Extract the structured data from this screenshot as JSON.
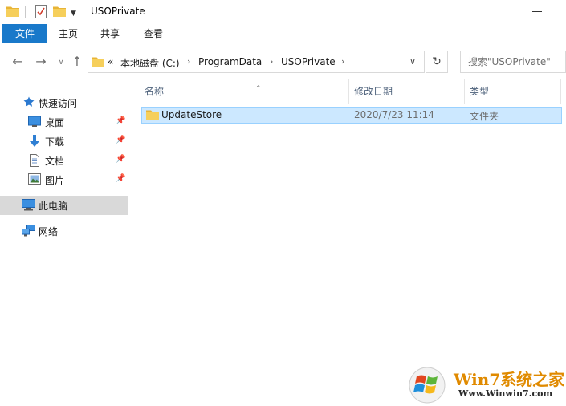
{
  "window": {
    "title": "USOPrivate"
  },
  "ribbon": {
    "tabs": [
      "文件",
      "主页",
      "共享",
      "查看"
    ]
  },
  "address": {
    "overflow": "«",
    "crumbs": [
      "本地磁盘 (C:)",
      "ProgramData",
      "USOPrivate"
    ]
  },
  "search": {
    "placeholder": "搜索\"USOPrivate\""
  },
  "nav": {
    "quick_access": "快速访问",
    "items": [
      {
        "label": "桌面",
        "icon": "desktop-icon",
        "pinned": true
      },
      {
        "label": "下载",
        "icon": "download-icon",
        "pinned": true
      },
      {
        "label": "文档",
        "icon": "document-icon",
        "pinned": true
      },
      {
        "label": "图片",
        "icon": "picture-icon",
        "pinned": true
      }
    ],
    "this_pc": "此电脑",
    "network": "网络"
  },
  "columns": {
    "name": "名称",
    "date": "修改日期",
    "type": "类型"
  },
  "files": [
    {
      "name": "UpdateStore",
      "date": "2020/7/23 11:14",
      "type": "文件夹"
    }
  ],
  "watermark": {
    "title": "Win7系统之家",
    "url": "Www.Winwin7.com"
  },
  "colors": {
    "file_tab": "#1979ca",
    "selection": "#cce8ff",
    "selection_border": "#99d1ff",
    "folder": "#f3c344",
    "header_text": "#4c607a"
  }
}
